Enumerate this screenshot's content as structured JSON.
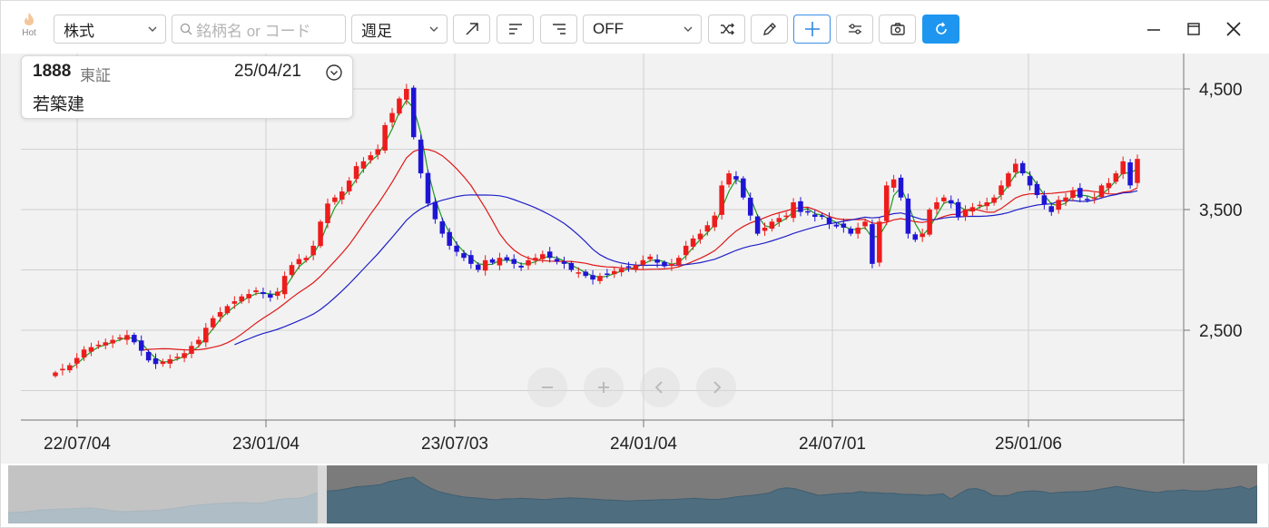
{
  "toolbar": {
    "hot_label": "Hot",
    "asset_type": "株式",
    "search_placeholder": "銘柄名 or コード",
    "period": "週足",
    "indicator": "OFF"
  },
  "info": {
    "code": "1888",
    "market": "東証",
    "date": "25/04/21",
    "name": "若築建"
  },
  "colors": {
    "up": "#ee1c1c",
    "down": "#1f14d6",
    "ma_short": "#1c9a1c",
    "ma_mid": "#e01818",
    "ma_long": "#2020c8",
    "primary": "#1e96f0"
  },
  "chart_data": {
    "type": "candlestick",
    "y_ticks": [
      "4,500",
      "3,500",
      "2,500"
    ],
    "x_ticks": [
      "22/07/04",
      "23/01/04",
      "23/07/03",
      "24/01/04",
      "24/07/01",
      "25/01/06"
    ],
    "ylim": [
      1800,
      4800
    ],
    "close_series": [
      2150,
      2180,
      2210,
      2270,
      2340,
      2360,
      2380,
      2400,
      2420,
      2440,
      2460,
      2400,
      2330,
      2250,
      2220,
      2240,
      2260,
      2280,
      2310,
      2370,
      2420,
      2520,
      2600,
      2650,
      2700,
      2740,
      2780,
      2800,
      2830,
      2800,
      2770,
      2820,
      2950,
      3040,
      3090,
      3100,
      3200,
      3400,
      3550,
      3600,
      3650,
      3740,
      3860,
      3900,
      3950,
      4000,
      4200,
      4300,
      4420,
      4500,
      4100,
      3800,
      3550,
      3420,
      3300,
      3200,
      3150,
      3100,
      3050,
      3000,
      3080,
      3060,
      3100,
      3080,
      3050,
      3020,
      3080,
      3100,
      3130,
      3100,
      3070,
      3050,
      3000,
      2980,
      2950,
      2920,
      2950,
      2970,
      2990,
      3010,
      3020,
      3040,
      3080,
      3110,
      3060,
      3030,
      3050,
      3100,
      3200,
      3260,
      3300,
      3370,
      3450,
      3700,
      3800,
      3750,
      3600,
      3450,
      3300,
      3350,
      3400,
      3430,
      3450,
      3560,
      3480,
      3480,
      3440,
      3440,
      3380,
      3360,
      3350,
      3300,
      3350,
      3400,
      3050,
      3400,
      3700,
      3750,
      3600,
      3300,
      3250,
      3300,
      3500,
      3560,
      3600,
      3550,
      3440,
      3500,
      3520,
      3540,
      3560,
      3600,
      3700,
      3800,
      3880,
      3800,
      3700,
      3620,
      3540,
      3480,
      3580,
      3600,
      3660,
      3600,
      3580,
      3600,
      3700,
      3720,
      3800,
      3900,
      3700,
      3920
    ]
  },
  "navigator": {
    "zoom_out_icon": "minus-icon",
    "zoom_in_icon": "plus-icon",
    "prev_icon": "chevron-left-icon",
    "next_icon": "chevron-right-icon"
  }
}
